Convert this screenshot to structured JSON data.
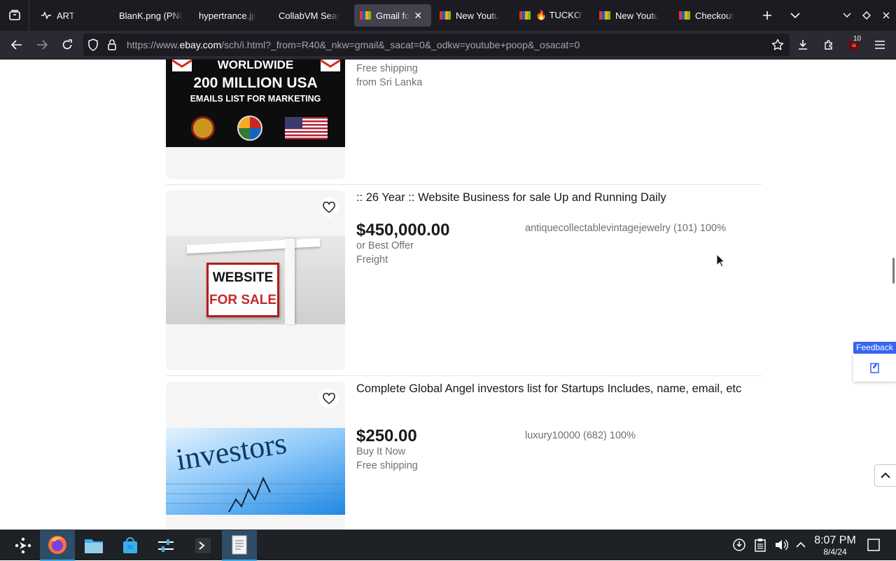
{
  "browser": {
    "tabs": [
      {
        "title": "ART",
        "active": false
      },
      {
        "title": "BlanK.png (PNG",
        "active": false
      },
      {
        "title": "hypertrance.jp",
        "active": false
      },
      {
        "title": "CollabVM Sear",
        "active": false
      },
      {
        "title": "Gmail fo",
        "active": true
      },
      {
        "title": "New Youtu",
        "active": false
      },
      {
        "title": "🔥 TUCKOT",
        "active": false
      },
      {
        "title": "New Youtu",
        "active": false
      },
      {
        "title": "Checkout",
        "active": false
      }
    ],
    "url_prefix": "https://www.",
    "url_domain": "ebay.com",
    "url_rest": "/sch/i.html?_from=R40&_nkw=gmail&_sacat=0&_odkw=youtube+poop&_osacat=0",
    "extension_badge": "10"
  },
  "listings": [
    {
      "image_lines": [
        "WORLDWIDE",
        "200 MILLION USA",
        "EMAILS LIST FOR MARKETING"
      ],
      "shipping": "Free shipping",
      "location": "from Sri Lanka"
    },
    {
      "title": ":: 26 Year :: Website Business for sale Up and Running Daily",
      "image_sign": [
        "WEBSITE",
        "FOR SALE"
      ],
      "price": "$450,000.00",
      "format": "or Best Offer",
      "shipping": "Freight",
      "seller": "antiquecollectablevintagejewelry (101) 100%"
    },
    {
      "title": "Complete Global Angel investors list for Startups Includes, name, email, etc",
      "image_word": "investors",
      "price": "$250.00",
      "format": "Buy It Now",
      "shipping": "Free shipping",
      "seller": "luxury10000 (682) 100%"
    }
  ],
  "feedback_label": "Feedback",
  "taskbar": {
    "time": "8:07 PM",
    "date": "8/4/24"
  },
  "colors": {
    "ebay_blue": "#3665f3",
    "active_task": "#2f4c69",
    "tab_active": "#42414d"
  }
}
